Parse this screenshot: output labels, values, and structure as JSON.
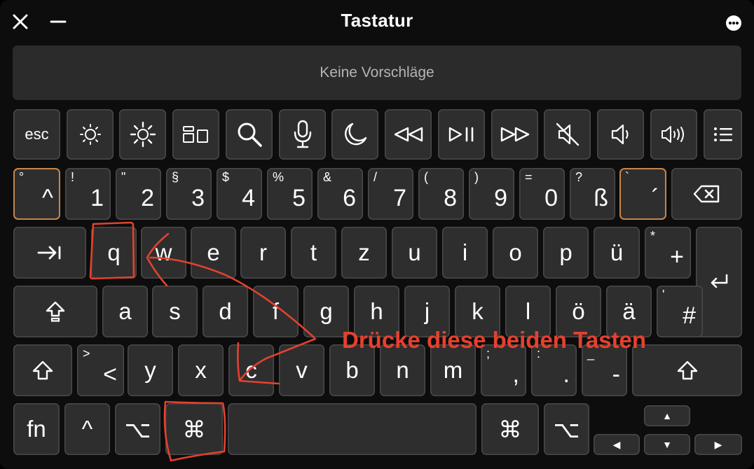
{
  "window": {
    "title": "Tastatur"
  },
  "suggestions": {
    "text": "Keine Vorschläge"
  },
  "fn_row": {
    "esc": "esc",
    "icons": [
      "brightness-down-icon",
      "brightness-up-icon",
      "mission-control-icon",
      "search-icon",
      "microphone-icon",
      "moon-icon",
      "rewind-icon",
      "play-pause-icon",
      "fast-forward-icon",
      "mute-icon",
      "volume-down-icon",
      "volume-up-icon",
      "list-icon"
    ]
  },
  "number_row": [
    {
      "sub": "°",
      "main": "^"
    },
    {
      "sub": "!",
      "main": "1"
    },
    {
      "sub": "\"",
      "main": "2"
    },
    {
      "sub": "§",
      "main": "3"
    },
    {
      "sub": "$",
      "main": "4"
    },
    {
      "sub": "%",
      "main": "5"
    },
    {
      "sub": "&",
      "main": "6"
    },
    {
      "sub": "/",
      "main": "7"
    },
    {
      "sub": "(",
      "main": "8"
    },
    {
      "sub": ")",
      "main": "9"
    },
    {
      "sub": "=",
      "main": "0"
    },
    {
      "sub": "?",
      "main": "ß"
    },
    {
      "sub": "`",
      "main": "´"
    }
  ],
  "row_q": [
    "q",
    "w",
    "e",
    "r",
    "t",
    "z",
    "u",
    "i",
    "o",
    "p",
    "ü"
  ],
  "row_q_plus": {
    "sub": "*",
    "main": "+"
  },
  "row_a": [
    "a",
    "s",
    "d",
    "f",
    "g",
    "h",
    "j",
    "k",
    "l",
    "ö",
    "ä"
  ],
  "row_a_hash": {
    "sub": "'",
    "main": "#"
  },
  "row_y_angle": {
    "sub": ">",
    "main": "<"
  },
  "row_y": [
    "y",
    "x",
    "c",
    "v",
    "b",
    "n",
    "m"
  ],
  "row_y_punct": [
    {
      "sub": ";",
      "main": ","
    },
    {
      "sub": ":",
      "main": "."
    },
    {
      "sub": "_",
      "main": "-"
    }
  ],
  "bottom": {
    "fn": "fn",
    "ctrl": "^",
    "opt": "⌥",
    "cmd": "⌘"
  },
  "arrows": {
    "up": "▲",
    "left": "◀",
    "down": "▼",
    "right": "▶"
  },
  "annotation": {
    "text": "Drücke diese beiden Tasten",
    "color": "#e5412e"
  },
  "colors": {
    "highlight_border": "#c8864a",
    "key_bg": "#2e2e2e"
  }
}
